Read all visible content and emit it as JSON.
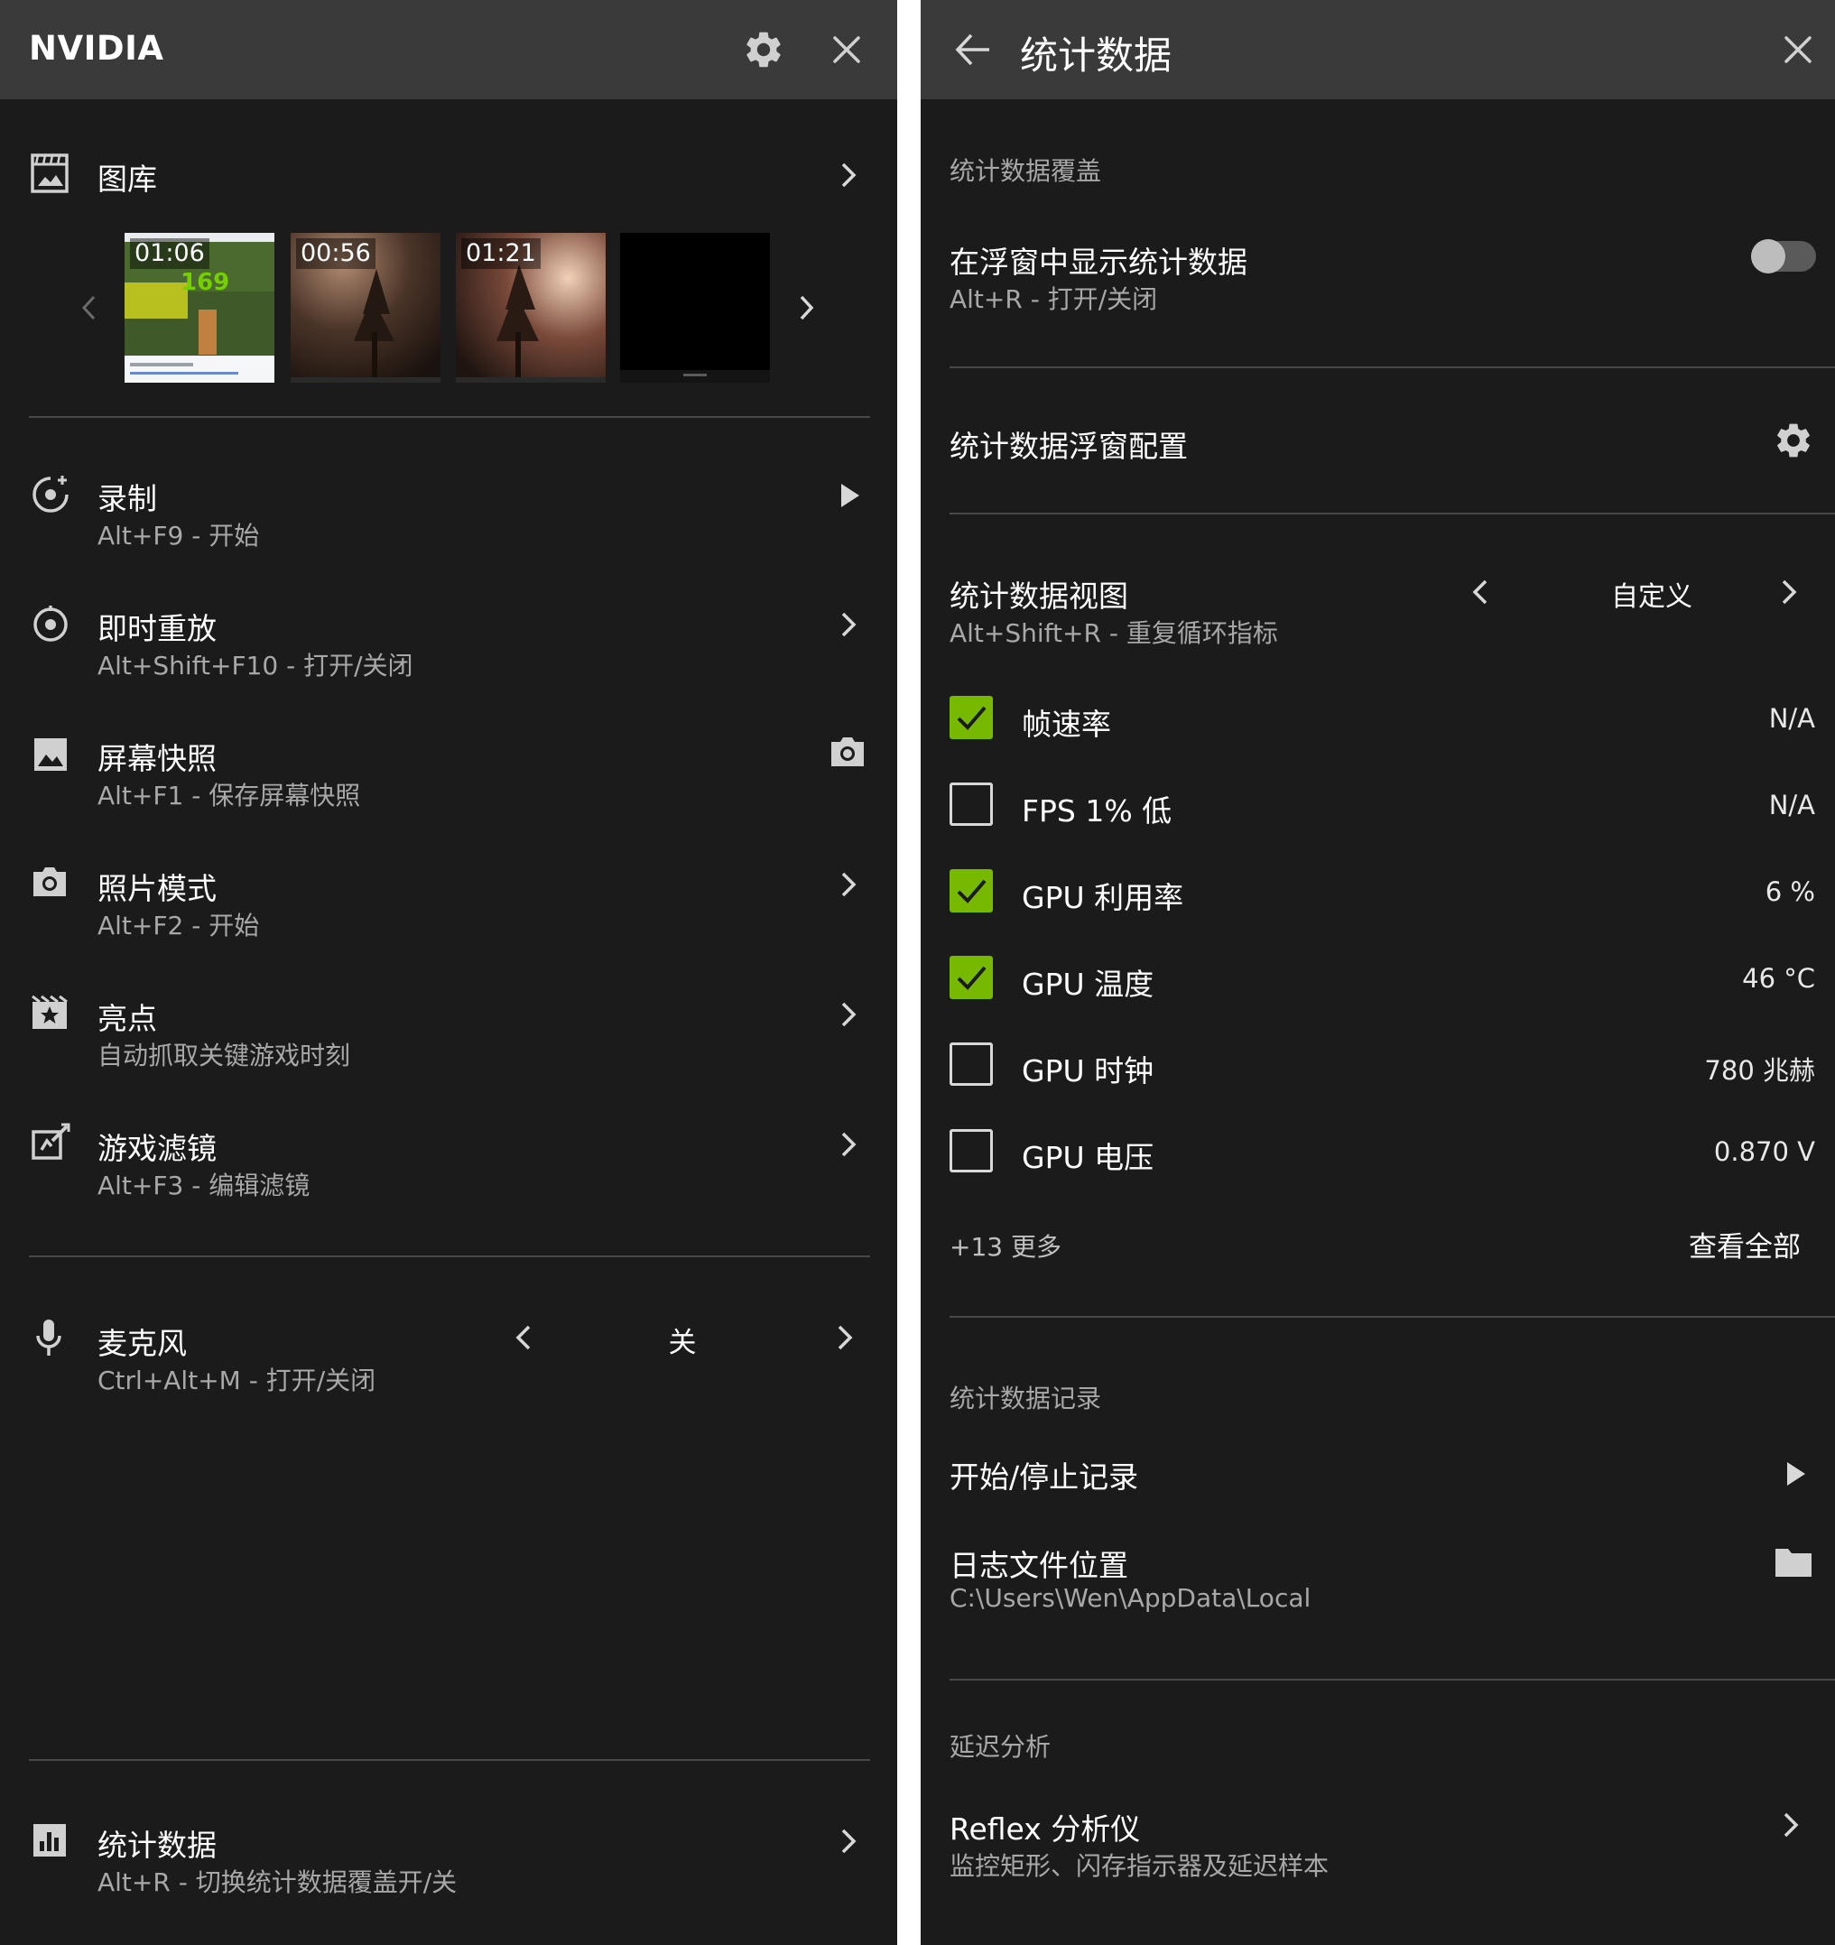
{
  "left_panel": {
    "title": "NVIDIA",
    "gallery": {
      "label": "图库",
      "thumbnails": [
        {
          "time": "01:06",
          "overlay_number": "169"
        },
        {
          "time": "00:56"
        },
        {
          "time": "01:21"
        },
        {
          "time": ""
        }
      ]
    },
    "menu": [
      {
        "label": "录制",
        "shortcut": "Alt+F9 - 开始",
        "icon": "record-icon",
        "action_icon": "play-icon"
      },
      {
        "label": "即时重放",
        "shortcut": "Alt+Shift+F10 - 打开/关闭",
        "icon": "instant-replay-icon",
        "action_icon": "chevron-right-icon"
      },
      {
        "label": "屏幕快照",
        "shortcut": "Alt+F1 - 保存屏幕快照",
        "icon": "image-icon",
        "action_icon": "camera-icon"
      },
      {
        "label": "照片模式",
        "shortcut": "Alt+F2 - 开始",
        "icon": "camera-icon",
        "action_icon": "chevron-right-icon"
      },
      {
        "label": "亮点",
        "shortcut": "自动抓取关键游戏时刻",
        "icon": "highlights-icon",
        "action_icon": "chevron-right-icon"
      },
      {
        "label": "游戏滤镜",
        "shortcut": "Alt+F3 - 编辑滤镜",
        "icon": "filter-icon",
        "action_icon": "chevron-right-icon"
      }
    ],
    "microphone": {
      "label": "麦克风",
      "shortcut": "Ctrl+Alt+M - 打开/关闭",
      "value": "关"
    },
    "stats": {
      "label": "统计数据",
      "shortcut": "Alt+R - 切换统计数据覆盖开/关"
    }
  },
  "right_panel": {
    "title": "统计数据",
    "overlay_section": "统计数据覆盖",
    "show_in_overlay": {
      "label": "在浮窗中显示统计数据",
      "shortcut": "Alt+R - 打开/关闭",
      "enabled": false
    },
    "overlay_config": {
      "label": "统计数据浮窗配置"
    },
    "stats_view": {
      "label": "统计数据视图",
      "shortcut": "Alt+Shift+R - 重复循环指标",
      "value": "自定义"
    },
    "metrics": [
      {
        "label": "帧速率",
        "value": "N/A",
        "checked": true
      },
      {
        "label": "FPS 1% 低",
        "value": "N/A",
        "checked": false
      },
      {
        "label": "GPU 利用率",
        "value": "6 %",
        "checked": true
      },
      {
        "label": "GPU 温度",
        "value": "46 °C",
        "checked": true
      },
      {
        "label": "GPU 时钟",
        "value": "780 兆赫",
        "checked": false
      },
      {
        "label": "GPU 电压",
        "value": "0.870 V",
        "checked": false
      }
    ],
    "more_text": "+13 更多",
    "view_all": "查看全部",
    "record_section": "统计数据记录",
    "start_stop": "开始/停止记录",
    "log_location": {
      "label": "日志文件位置",
      "path": "C:\\Users\\Wen\\AppData\\Local"
    },
    "latency_section": "延迟分析",
    "reflex": {
      "label": "Reflex 分析仪",
      "description": "监控矩形、闪存指示器及延迟样本"
    }
  },
  "colors": {
    "accent": "#76b900",
    "panel_bg": "#1b1b1b",
    "titlebar_bg": "#3a3a3a",
    "divider": "#484848",
    "secondary_text": "#a8a8a8"
  }
}
